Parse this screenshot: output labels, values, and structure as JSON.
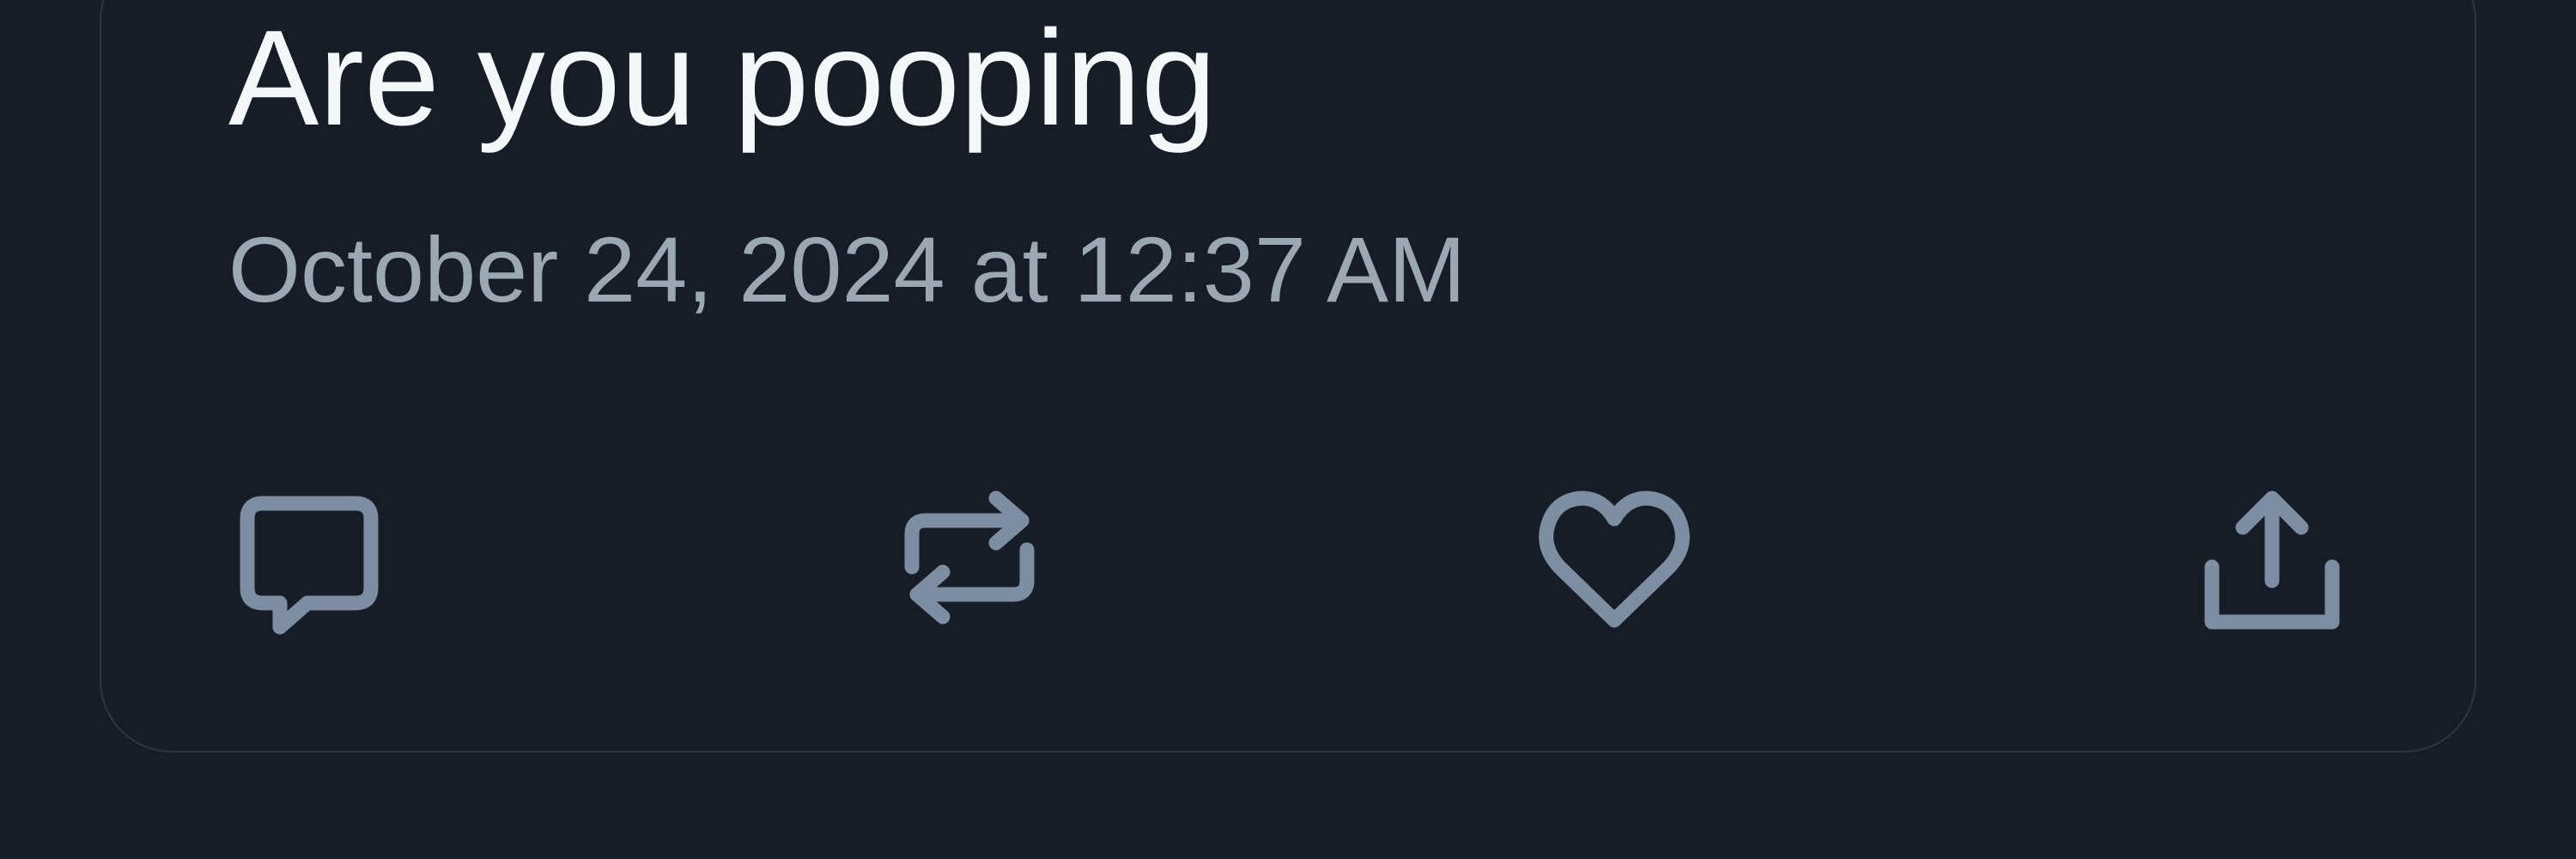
{
  "tweet": {
    "text": "Are you pooping",
    "timestamp": "October 24, 2024 at 12:37 AM"
  },
  "actions": {
    "reply": {
      "icon": "reply-icon"
    },
    "retweet": {
      "icon": "retweet-icon"
    },
    "like": {
      "icon": "heart-icon"
    },
    "share": {
      "icon": "share-icon"
    }
  },
  "colors": {
    "background": "#161d27",
    "text": "#f5f8fa",
    "secondary_text": "#9ba7b3",
    "icon": "#7d8ea3",
    "border": "#2c3742"
  }
}
